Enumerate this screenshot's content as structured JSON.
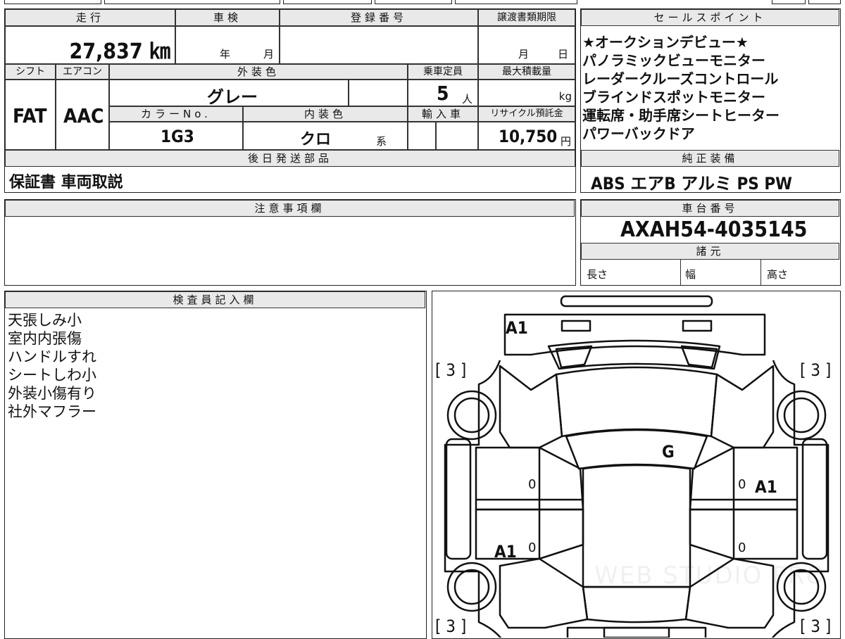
{
  "mileage": {
    "header": "走行",
    "value": "27,837 ㎞"
  },
  "shaken": {
    "header": "車検",
    "year_unit": "年",
    "month_unit": "月"
  },
  "registration": {
    "header": "登録番号"
  },
  "transfer_deadline": {
    "header": "譲渡書類期限",
    "month_unit": "月",
    "day_unit": "日"
  },
  "sales_points": {
    "header": "セールスポイント",
    "items": [
      "★オークションデビュー★",
      "パノラミックビューモニター",
      "レーダークルーズコントロール",
      "ブラインドスポットモニター",
      "運転席・助手席シートヒーター",
      "パワーバックドア"
    ]
  },
  "shift": {
    "header": "シフト",
    "value": "FAT"
  },
  "aircon": {
    "header": "エアコン",
    "value": "AAC"
  },
  "exterior_color": {
    "header": "外装色",
    "value": "グレー"
  },
  "capacity": {
    "header": "乗車定員",
    "value": "5",
    "unit": "人"
  },
  "max_load": {
    "header": "最大積載量",
    "unit": "kg"
  },
  "color_no": {
    "header": "カラーNo.",
    "value": "1G3"
  },
  "interior_color": {
    "header": "内装色",
    "value": "クロ",
    "unit": "系"
  },
  "import": {
    "header": "輸入車"
  },
  "recycle_fee": {
    "header": "リサイクル預託金",
    "value": "10,750",
    "unit": "円"
  },
  "later_parts": {
    "header": "後日発送部品",
    "value": "保証書 車両取説"
  },
  "genuine_equipment": {
    "header": "純正装備",
    "value": "ABS エアB アルミ PS PW"
  },
  "notes": {
    "header": "注意事項欄"
  },
  "chassis": {
    "header": "車台番号",
    "value": "AXAH54-4035145"
  },
  "specs": {
    "header": "諸元",
    "length": "長さ",
    "width": "幅",
    "height": "高さ"
  },
  "inspector": {
    "header": "検査員記入欄",
    "lines": [
      "天張しみ小",
      "室内内張傷",
      "ハンドルすれ",
      "シートしわ小",
      "外装小傷有り",
      "社外マフラー"
    ]
  },
  "diagram": {
    "marks": [
      {
        "id": "front-bumper",
        "text": "A1"
      },
      {
        "id": "windshield",
        "text": "G"
      },
      {
        "id": "right-rear-door",
        "text": "A1"
      },
      {
        "id": "left-rear-door",
        "text": "A1"
      }
    ],
    "tire_fl": "[ 3 ]",
    "tire_fr": "[ 3 ]",
    "tire_rl": "[ 3 ]",
    "tire_rr": "[ 3 ]",
    "door_zero": "0",
    "watermark": "WEB STUDIO PRO"
  }
}
